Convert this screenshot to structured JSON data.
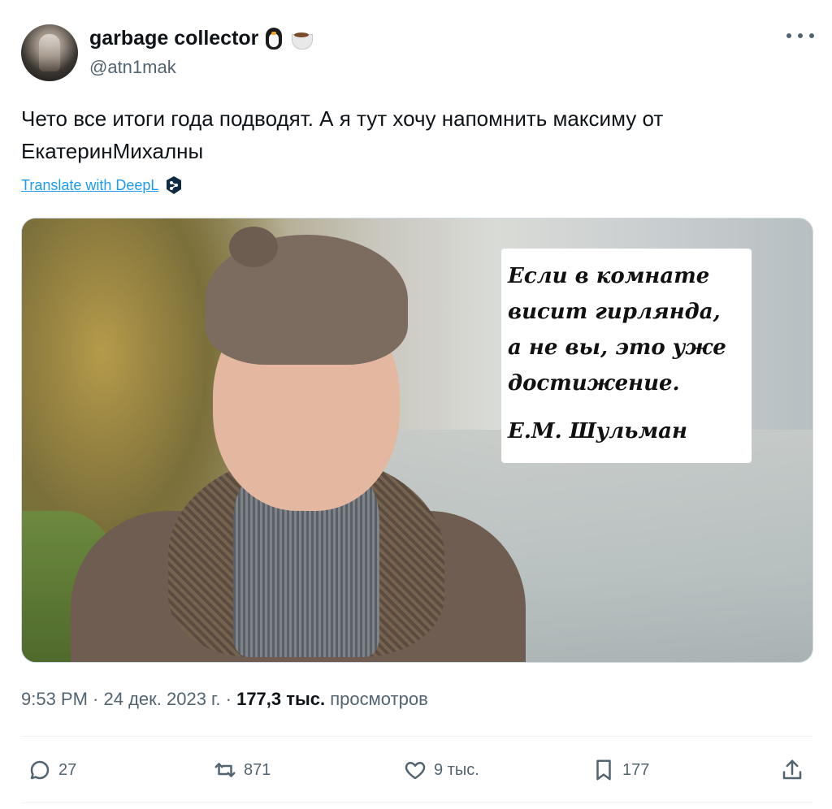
{
  "author": {
    "display_name": "garbage collector",
    "emoji_1": "penguin-emoji",
    "emoji_2": "coffee-cup-emoji",
    "handle": "@atn1mak"
  },
  "tweet": {
    "text": "Чето все итоги года подводят. А я тут хочу напомнить максиму от ЕкатеринМихалны",
    "translate_label": "Translate with DeepL"
  },
  "media": {
    "quote_text": "Если в комнате\nвисит гирлянда,\nа не вы, это уже\nдостижение.",
    "quote_author": "Е.М. Шульман"
  },
  "meta": {
    "time": "9:53 PM",
    "separator_1": " · ",
    "date": "24 дек. 2023 г.",
    "separator_2": " · ",
    "views_count": "177,3 тыс.",
    "views_label": " просмотров"
  },
  "actions": {
    "replies": "27",
    "reposts": "871",
    "likes": "9 тыс.",
    "bookmarks": "177"
  },
  "colors": {
    "accent": "#1d9bf0",
    "secondary_text": "#536471",
    "primary_text": "#0f1419"
  },
  "icons": [
    "more-icon",
    "deepl-icon",
    "reply-icon",
    "repost-icon",
    "like-icon",
    "bookmark-icon",
    "share-icon"
  ]
}
